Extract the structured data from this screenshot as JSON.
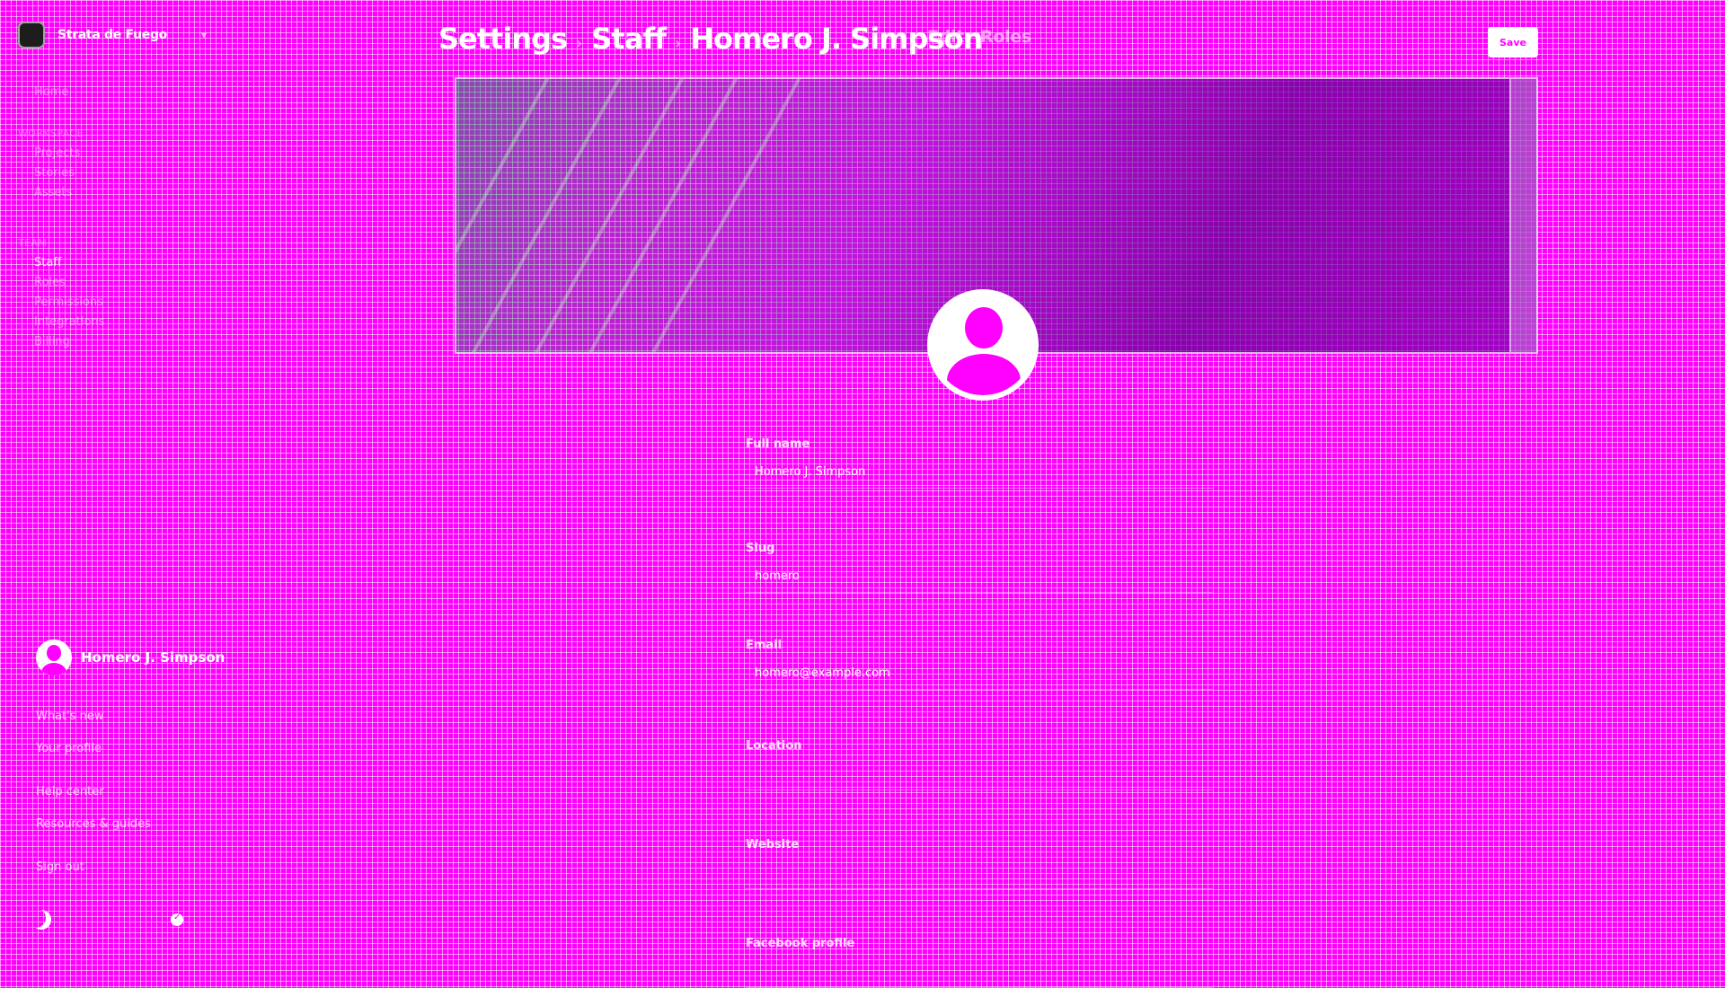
{
  "brand": {
    "name": "Strata de Fuego"
  },
  "sidebar": {
    "nav": [
      {
        "label": "Home",
        "section": false
      },
      {
        "label": "Workspace",
        "section": true
      },
      {
        "label": "Projects",
        "section": false
      },
      {
        "label": "Stories",
        "section": false
      },
      {
        "label": "Assets",
        "section": false
      },
      {
        "label": "Team",
        "section": true
      },
      {
        "label": "Staff",
        "section": false,
        "active": true
      },
      {
        "label": "Roles",
        "section": false
      },
      {
        "label": "Permissions",
        "section": false
      },
      {
        "label": "Integrations",
        "section": false
      },
      {
        "label": "Billing",
        "section": false
      }
    ],
    "user_name": "Homero J. Simpson",
    "menu": [
      "What's new",
      "Your profile",
      "Help center",
      "Resources & guides",
      "Sign out"
    ]
  },
  "header": {
    "breadcrumb": [
      "Settings",
      "Staff",
      "Homero J. Simpson"
    ],
    "tabs": [
      "Edit",
      "Roles"
    ],
    "save_label": "Save"
  },
  "form": {
    "fields": [
      {
        "label": "Full name",
        "value": "Homero J. Simpson",
        "placeholder": ""
      },
      {
        "label": "Slug",
        "value": "homero",
        "placeholder": ""
      },
      {
        "label": "Email",
        "value": "homero@example.com",
        "placeholder": ""
      },
      {
        "label": "Location",
        "value": "",
        "placeholder": ""
      },
      {
        "label": "Website",
        "value": "",
        "placeholder": ""
      },
      {
        "label": "Facebook profile",
        "value": "",
        "placeholder": ""
      }
    ]
  },
  "colors": {
    "background": "#ff00ff",
    "accent": "#ffffff"
  }
}
